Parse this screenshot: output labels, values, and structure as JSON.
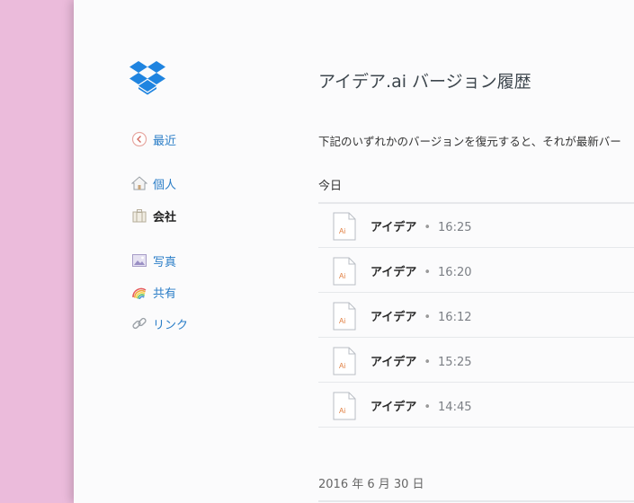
{
  "page": {
    "title": "アイデア.ai バージョン履歴",
    "description": "下記のいずれかのバージョンを復元すると、それが最新バー"
  },
  "nav": {
    "recent": {
      "label": "最近",
      "icon": "clock-back-icon"
    },
    "personal": {
      "label": "個人",
      "icon": "home-icon"
    },
    "company": {
      "label": "会社",
      "icon": "briefcase-icon"
    },
    "photos": {
      "label": "写真",
      "icon": "photo-icon"
    },
    "shared": {
      "label": "共有",
      "icon": "rainbow-icon"
    },
    "links": {
      "label": "リンク",
      "icon": "link-icon"
    }
  },
  "groups": [
    {
      "heading": "今日",
      "versions": [
        {
          "name": "アイデア",
          "separator": "•",
          "time": "16:25",
          "icon_text": "Ai"
        },
        {
          "name": "アイデア",
          "separator": "•",
          "time": "16:20",
          "icon_text": "Ai"
        },
        {
          "name": "アイデア",
          "separator": "•",
          "time": "16:12",
          "icon_text": "Ai"
        },
        {
          "name": "アイデア",
          "separator": "•",
          "time": "15:25",
          "icon_text": "Ai"
        },
        {
          "name": "アイデア",
          "separator": "•",
          "time": "14:45",
          "icon_text": "Ai"
        }
      ]
    },
    {
      "heading": "2016 年 6 月 30 日",
      "versions": []
    }
  ],
  "colors": {
    "accent": "#2a7dc7",
    "dropbox_blue": "#1f84e0",
    "background_pink": "#e9bada",
    "ai_orange": "#e07c3c"
  }
}
